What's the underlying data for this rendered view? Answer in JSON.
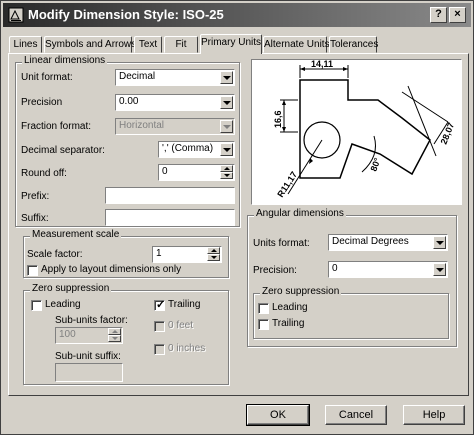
{
  "window": {
    "title": "Modify Dimension Style: ISO-25",
    "help_glyph": "?",
    "close_glyph": "×"
  },
  "tabs": [
    {
      "label": "Lines"
    },
    {
      "label": "Symbols and Arrows"
    },
    {
      "label": "Text"
    },
    {
      "label": "Fit"
    },
    {
      "label": "Primary Units",
      "active": true
    },
    {
      "label": "Alternate Units"
    },
    {
      "label": "Tolerances"
    }
  ],
  "linear": {
    "title": "Linear dimensions",
    "unit_format_label": "Unit format:",
    "unit_format_value": "Decimal",
    "precision_label": "Precision",
    "precision_value": "0.00",
    "fraction_format_label": "Fraction format:",
    "fraction_format_value": "Horizontal",
    "decimal_sep_label": "Decimal separator:",
    "decimal_sep_value": "',' (Comma)",
    "round_off_label": "Round off:",
    "round_off_value": "0",
    "prefix_label": "Prefix:",
    "prefix_value": "",
    "suffix_label": "Suffix:",
    "suffix_value": ""
  },
  "measurement": {
    "title": "Measurement scale",
    "scale_label": "Scale factor:",
    "scale_value": "1",
    "apply_layout_label": "Apply to layout dimensions only",
    "apply_layout_checked": false
  },
  "zero_linear": {
    "title": "Zero suppression",
    "leading_label": "Leading",
    "leading_checked": false,
    "trailing_label": "Trailing",
    "trailing_checked": true,
    "subunits_factor_label": "Sub-units factor:",
    "subunits_factor_value": "100",
    "zero_feet_label": "0 feet",
    "zero_inches_label": "0 inches",
    "subunit_suffix_label": "Sub-unit suffix:",
    "subunit_suffix_value": ""
  },
  "preview": {
    "dim_top": "14,11",
    "dim_left": "16,6",
    "dim_right": "28,07",
    "dim_angle": "80°",
    "dim_radius": "R11,17"
  },
  "angular": {
    "title": "Angular dimensions",
    "units_format_label": "Units format:",
    "units_format_value": "Decimal Degrees",
    "precision_label": "Precision:",
    "precision_value": "0"
  },
  "zero_angular": {
    "title": "Zero suppression",
    "leading_label": "Leading",
    "leading_checked": false,
    "trailing_label": "Trailing",
    "trailing_checked": false
  },
  "buttons": {
    "ok": "OK",
    "cancel": "Cancel",
    "help": "Help"
  }
}
